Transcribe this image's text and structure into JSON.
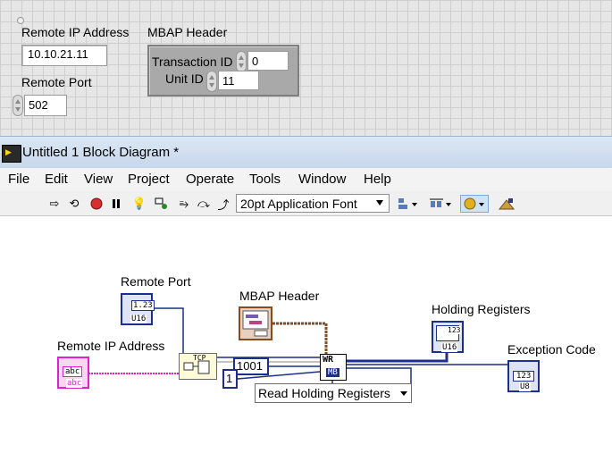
{
  "front_panel": {
    "remote_ip": {
      "label": "Remote IP Address",
      "value": "10.10.21.11"
    },
    "remote_port": {
      "label": "Remote Port",
      "value": "502"
    },
    "mbap_header": {
      "label": "MBAP Header",
      "transaction_id": {
        "label": "Transaction ID",
        "value": "0"
      },
      "unit_id": {
        "label": "Unit ID",
        "value": "11"
      }
    }
  },
  "window": {
    "title": "Untitled 1 Block Diagram *"
  },
  "menu": [
    "File",
    "Edit",
    "View",
    "Project",
    "Operate",
    "Tools",
    "Window",
    "Help"
  ],
  "toolbar": {
    "font": "20pt Application Font"
  },
  "diagram": {
    "remote_port_label": "Remote Port",
    "remote_ip_label": "Remote IP Address",
    "mbap_label": "MBAP Header",
    "holding_label": "Holding Registers",
    "exception_label": "Exception Code",
    "const_1001": "1001",
    "const_1": "1",
    "function_enum": "Read Holding Registers",
    "tcp_node": "TCP",
    "wr_node_top": "WR",
    "wr_node_bottom": "MB",
    "port_term_text": "1.23",
    "port_term_type": "U16",
    "ip_term_text": "abc",
    "ip_term_type": "abc",
    "mbap_term_type": "",
    "holding_term_text": "123",
    "holding_term_type": "U16",
    "exception_term_text": "123",
    "exception_term_type": "U8"
  },
  "colors": {
    "numeric_wire": "#1c2f8c",
    "string_wire": "#e020c8",
    "cluster_wire": "#8a4a1c"
  }
}
